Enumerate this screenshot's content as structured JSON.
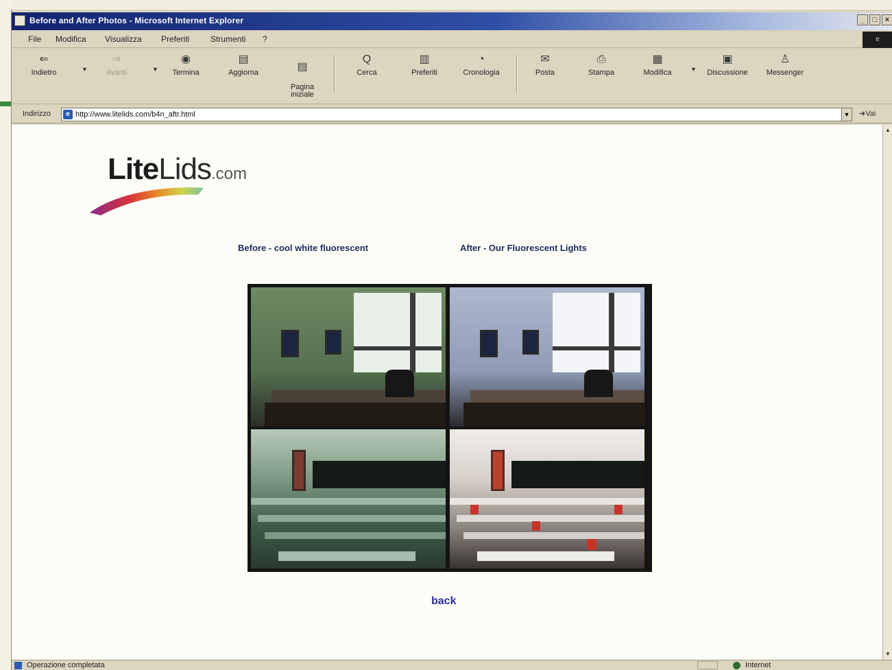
{
  "window": {
    "title": "Before and After Photos - Microsoft Internet Explorer",
    "controls": [
      "_",
      "□",
      "×"
    ]
  },
  "menu": [
    "File",
    "Modifica",
    "Visualizza",
    "Preferiti",
    "Strumenti",
    "?"
  ],
  "toolbar": {
    "buttons": [
      {
        "label": "Indietro",
        "icon": "back-arrow-icon",
        "glyph": "⇐"
      },
      {
        "label": "Avanti",
        "icon": "forward-arrow-icon",
        "glyph": "⇒"
      },
      {
        "label": "Termina",
        "icon": "stop-icon",
        "glyph": "◉"
      },
      {
        "label": "Aggiorna",
        "icon": "refresh-icon",
        "glyph": "▤"
      },
      {
        "label": "Pagina\niniziale",
        "icon": "home-icon",
        "glyph": "▤"
      },
      {
        "label": "Cerca",
        "icon": "search-icon",
        "glyph": "Q"
      },
      {
        "label": "Preferiti",
        "icon": "favorites-icon",
        "glyph": "▥"
      },
      {
        "label": "Cronologia",
        "icon": "history-icon",
        "glyph": "◔"
      },
      {
        "label": "Posta",
        "icon": "mail-icon",
        "glyph": "✉"
      },
      {
        "label": "Stampa",
        "icon": "print-icon",
        "glyph": "⎙"
      },
      {
        "label": "Modifica",
        "icon": "edit-icon",
        "glyph": "▦"
      },
      {
        "label": "Discussione",
        "icon": "discuss-icon",
        "glyph": "▣"
      },
      {
        "label": "Messenger",
        "icon": "messenger-icon",
        "glyph": "♙"
      }
    ]
  },
  "address": {
    "label": "Indirizzo",
    "url": "http://www.litelids.com/b4n_aftr.html",
    "go": "Vai"
  },
  "page": {
    "logo": {
      "lite": "Lite",
      "lids": "Lids",
      "dotcom": ".com"
    },
    "caption_before": "Before - cool white fluorescent",
    "caption_after": "After - Our Fluorescent Lights",
    "back": "back"
  },
  "status": {
    "text": "Operazione completata",
    "zone": "Internet"
  }
}
